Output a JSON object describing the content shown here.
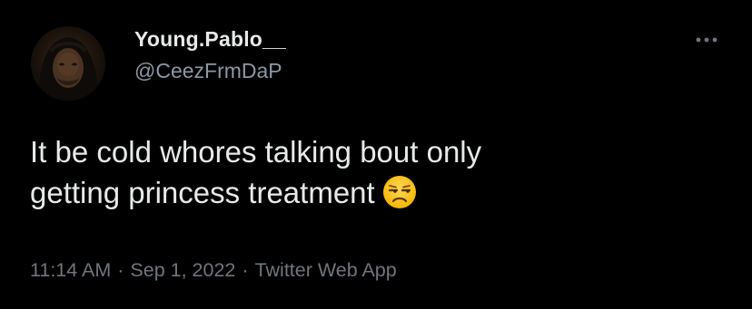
{
  "author": {
    "display_name": "Young.Pablo__",
    "handle": "@CeezFrmDaP"
  },
  "tweet": {
    "text_line_1": "It be cold whores talking bout only",
    "text_line_2": "getting princess treatment",
    "emoji": "unamused-face"
  },
  "meta": {
    "time": "11:14 AM",
    "separator": "·",
    "date": "Sep 1, 2022",
    "source": "Twitter Web App"
  },
  "icons": {
    "more": "more-horizontal-icon"
  },
  "colors": {
    "background": "#000000",
    "primary_text": "#e7e9ea",
    "secondary_text": "#71767b",
    "handle_text": "#8b98a5"
  }
}
